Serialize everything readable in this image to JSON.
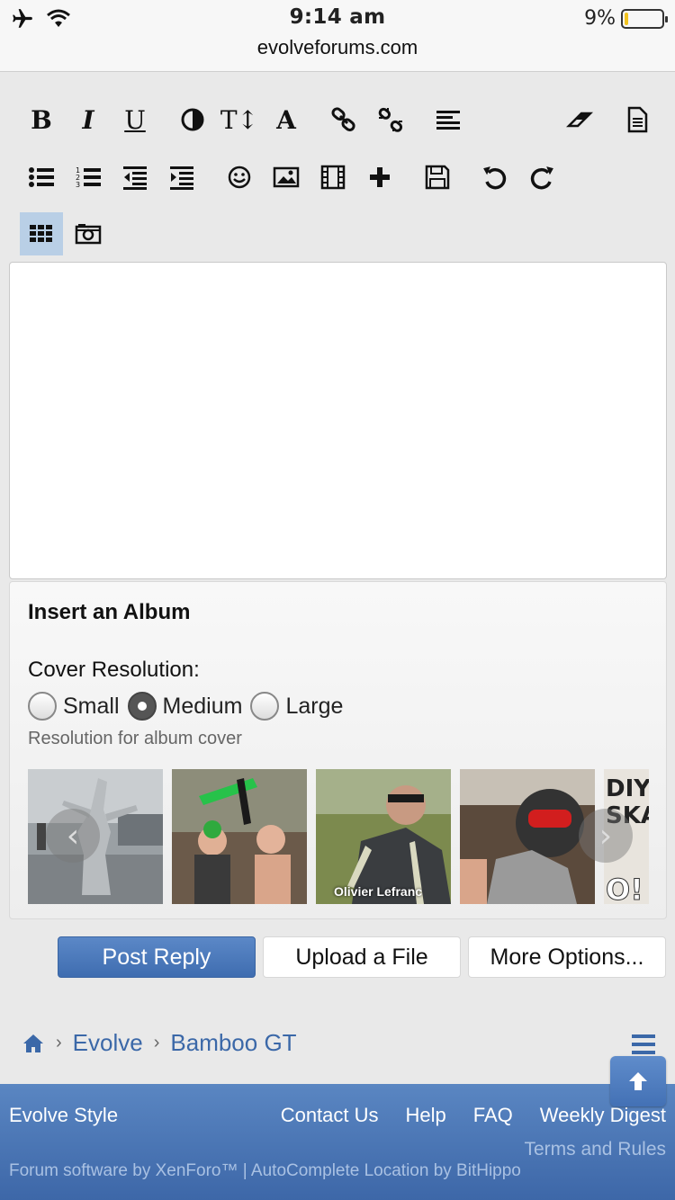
{
  "status_bar": {
    "time": "9:14 am",
    "battery_percent": "9%",
    "battery_level": 0.09,
    "url": "evolveforums.com"
  },
  "toolbar": {
    "bold": "B",
    "italic": "I",
    "underline": "U",
    "font_size": "T↕",
    "font_family": "A"
  },
  "album": {
    "title": "Insert an Album",
    "cover_label": "Cover Resolution:",
    "options": [
      "Small",
      "Medium",
      "Large"
    ],
    "selected": "Medium",
    "hint": "Resolution for album cover",
    "thumb_caption": "Olivier Lefranc",
    "thumb_text_1": "DIY",
    "thumb_text_2": "SKAT",
    "thumb_text_3": "O!"
  },
  "buttons": {
    "post_reply": "Post Reply",
    "upload": "Upload a File",
    "more": "More Options..."
  },
  "breadcrumb": [
    "Evolve",
    "Bamboo GT"
  ],
  "footer": {
    "style": "Evolve Style",
    "links": [
      "Contact Us",
      "Help",
      "FAQ",
      "Weekly Digest"
    ],
    "terms": "Terms and Rules",
    "copyright": "Forum software by XenForo™ | AutoComplete Location by BitHippo"
  },
  "colors": {
    "accent": "#3b68a8",
    "active_tool": "#b9cfe6",
    "battery": "#f2c31f"
  }
}
